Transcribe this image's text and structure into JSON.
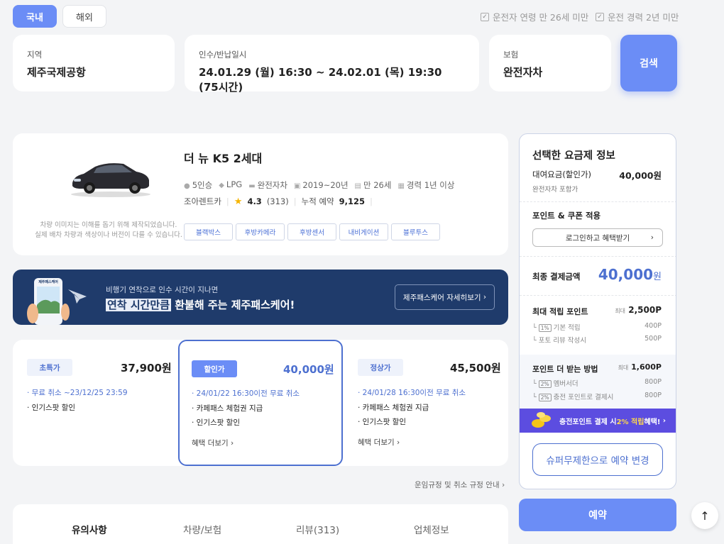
{
  "tabs": {
    "domestic": "국내",
    "overseas": "해외"
  },
  "conditions": {
    "age": "운전자 연령 만 26세 미만",
    "experience": "운전 경력 2년 미만"
  },
  "search": {
    "region_label": "지역",
    "region_value": "제주국제공항",
    "date_label": "인수/반납일시",
    "date_value": "24.01.29 (월) 16:30 ~ 24.02.01 (목) 19:30 (75시간)",
    "insurance_label": "보험",
    "insurance_value": "완전자차",
    "button": "검색"
  },
  "car": {
    "title": "더 뉴 K5 2세대",
    "note_line1": "차량 이미지는 이해를 돕기 위해 제작되었습니다.",
    "note_line2": "실제 배차 차량과 색상이나 버전이 다를 수 있습니다.",
    "specs": [
      "5인승",
      "LPG",
      "완전자차",
      "2019~20년",
      "만 26세",
      "경력 1년 이상"
    ],
    "company": "조아렌트카",
    "rating": "4.3",
    "reviews": "(313)",
    "bookings_label": "누적 예약",
    "bookings": "9,125",
    "options": [
      "블랙박스",
      "후방카메라",
      "후방센서",
      "내비게이션",
      "블루투스"
    ]
  },
  "banner": {
    "sub": "비행기 연착으로 인수 시간이 지나면",
    "highlight": "연착 시간만큼",
    "main": " 환불해 주는 제주패스케어!",
    "button": "제주패스케어 자세히보기",
    "phone_label": "제주패스케어"
  },
  "plans": [
    {
      "badge": "초특가",
      "price": "37,900원",
      "line1": "· 무료 취소 ~23/12/25 23:59",
      "line2": "· 인기스팟 할인",
      "line3": "",
      "more": ""
    },
    {
      "badge": "할인가",
      "price": "40,000원",
      "line1": "· 24/01/22 16:30이전 무료 취소",
      "line2": "· 카페패스 체험권 지급",
      "line3": "· 인기스팟 할인",
      "more": "혜택 더보기"
    },
    {
      "badge": "정상가",
      "price": "45,500원",
      "line1": "· 24/01/28 16:30이전 무료 취소",
      "line2": "· 카페패스 체험권 지급",
      "line3": "· 인기스팟 할인",
      "more": "혜택 더보기"
    }
  ],
  "rules_link": "운임규정 및 취소 규정 안내",
  "info_tabs": [
    "유의사항",
    "차량/보험",
    "리뷰(313)",
    "업체정보"
  ],
  "sidebar": {
    "title": "선택한 요금제 정보",
    "fee_label": "대여요금(할인가)",
    "fee_value": "40,000원",
    "fee_sub": "완전자차 포함가",
    "points_title": "포인트 & 쿠폰 적용",
    "login_button": "로그인하고 혜택받기",
    "final_label": "최종 결제금액",
    "final_value": "40,000",
    "final_unit": "원",
    "max_points_label": "최대 적립 포인트",
    "max_prefix": "최대",
    "max_points_value": "2,500P",
    "basic_pct": "1%",
    "basic_label": "기본 적립",
    "basic_value": "400P",
    "photo_label": "포토 리뷰 작성시",
    "photo_value": "500P",
    "more_title": "포인트 더 받는 방법",
    "more_value": "1,600P",
    "member_pct": "2%",
    "member_label": "멤버서더",
    "member_value": "800P",
    "charge_pct": "2%",
    "charge_label": "충전 포인트로 결제시",
    "charge_value": "800P",
    "promo_pre": "충전포인트 결제 시 ",
    "promo_hl": "2% 적립",
    "promo_post": " 혜택!",
    "change_button": "슈퍼무제한으로 예약 변경"
  },
  "book_button": "예약",
  "colors": {
    "primary": "#6b8df6",
    "navy": "#1f3b6b",
    "accent_blue": "#4d70d0",
    "purple": "#5c4de0"
  }
}
